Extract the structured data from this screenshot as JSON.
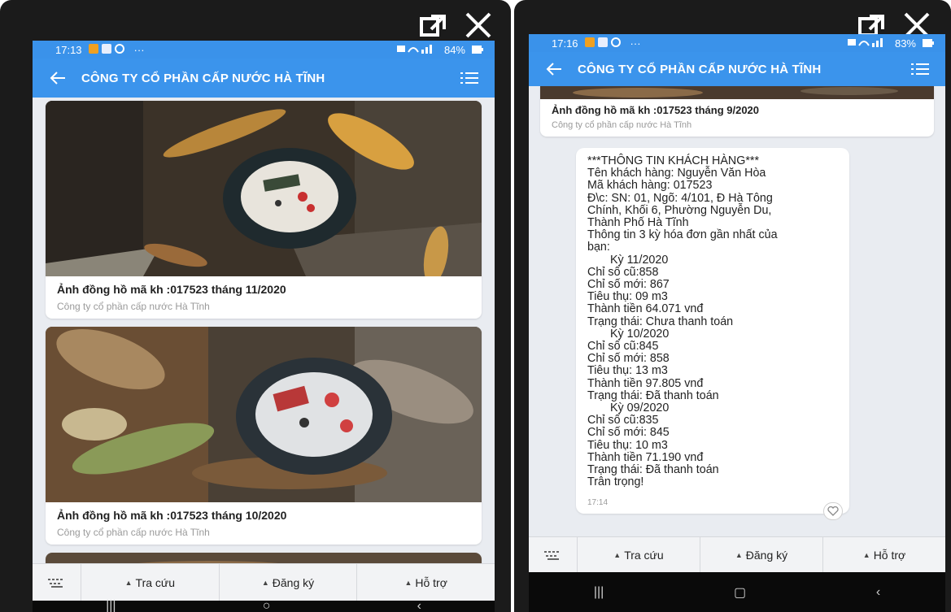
{
  "colors": {
    "header_blue": "#3b94ec",
    "status_blue": "#3a92ea",
    "chat_bg": "#e9ecf1"
  },
  "screen_left": {
    "status": {
      "time": "17:13",
      "dots": "···",
      "battery": "84%"
    },
    "appbar": {
      "title": "CÔNG TY CỔ PHẦN CẤP NƯỚC HÀ TĨNH"
    },
    "cards": [
      {
        "caption": "Ảnh đồng hồ mã kh :017523 tháng 11/2020",
        "source": "Công ty cổ phần cấp nước Hà Tĩnh"
      },
      {
        "caption": "Ảnh đồng hồ mã kh :017523 tháng 10/2020",
        "source": "Công ty cổ phần cấp nước Hà Tĩnh"
      }
    ],
    "menu": [
      "Tra cứu",
      "Đăng ký",
      "Hỗ trợ"
    ]
  },
  "screen_right": {
    "status": {
      "time": "17:16",
      "dots": "···",
      "battery": "83%"
    },
    "appbar": {
      "title": "CÔNG TY CỔ PHẦN CẤP NƯỚC HÀ TĨNH"
    },
    "top_card": {
      "caption": "Ảnh đồng hồ mã kh :017523 tháng 9/2020",
      "source": "Công ty cổ phần cấp nước Hà Tĩnh"
    },
    "message": {
      "lines": [
        "***THÔNG TIN KHÁCH HÀNG***",
        "Tên khách hàng: Nguyễn Văn Hòa",
        "Mã khách hàng: 017523",
        "Đ\\c: SN: 01, Ngõ: 4/101, Đ Hà Tông",
        "Chính, Khối 6, Phường Nguyễn Du,",
        "Thành Phố Hà Tĩnh",
        "Thông tin 3 kỳ hóa đơn gần nhất của",
        "bạn:",
        "Kỳ 11/2020",
        "Chỉ số cũ:858",
        "Chỉ số mới: 867",
        "Tiêu thụ: 09 m3",
        "Thành tiền 64.071 vnđ",
        "Trạng thái: Chưa thanh toán",
        "Kỳ 10/2020",
        "Chỉ số cũ:845",
        "Chỉ số mới: 858",
        "Tiêu thụ: 13 m3",
        "Thành tiền 97.805 vnđ",
        "Trạng thái: Đã thanh toán",
        "Kỳ 09/2020",
        "Chỉ số cũ:835",
        "Chỉ số mới: 845",
        "Tiêu thụ: 10 m3",
        "Thành tiền 71.190 vnđ",
        "Trạng thái: Đã thanh toán",
        "Trân trọng!"
      ],
      "time": "17:14"
    },
    "menu": [
      "Tra cứu",
      "Đăng ký",
      "Hỗ trợ"
    ]
  }
}
